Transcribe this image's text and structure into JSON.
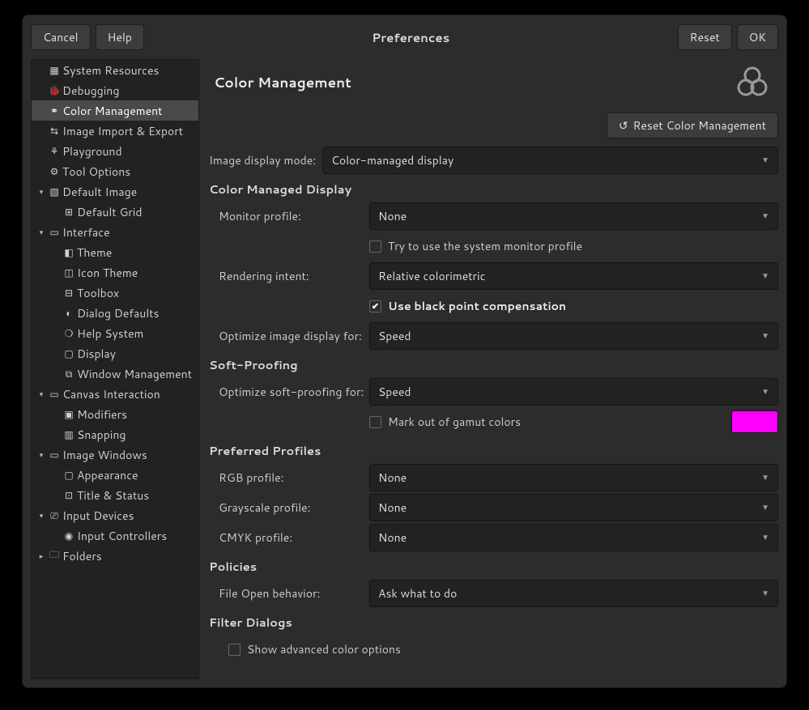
{
  "titlebar": {
    "cancel": "Cancel",
    "help": "Help",
    "title": "Preferences",
    "reset": "Reset",
    "ok": "OK"
  },
  "sidebar": {
    "items": [
      {
        "icon": "▦",
        "label": "System Resources",
        "indent": 1,
        "exp": ""
      },
      {
        "icon": "🐞",
        "label": "Debugging",
        "indent": 1,
        "exp": ""
      },
      {
        "icon": "⚭",
        "label": "Color Management",
        "indent": 1,
        "exp": "",
        "selected": true
      },
      {
        "icon": "⇆",
        "label": "Image Import & Export",
        "indent": 1,
        "exp": ""
      },
      {
        "icon": "⚘",
        "label": "Playground",
        "indent": 1,
        "exp": ""
      },
      {
        "icon": "⚙",
        "label": "Tool Options",
        "indent": 1,
        "exp": ""
      },
      {
        "icon": "▧",
        "label": "Default Image",
        "indent": 0,
        "exp": "▾"
      },
      {
        "icon": "⊞",
        "label": "Default Grid",
        "indent": 2,
        "exp": ""
      },
      {
        "icon": "▭",
        "label": "Interface",
        "indent": 0,
        "exp": "▾"
      },
      {
        "icon": "◧",
        "label": "Theme",
        "indent": 2,
        "exp": ""
      },
      {
        "icon": "◫",
        "label": "Icon Theme",
        "indent": 2,
        "exp": ""
      },
      {
        "icon": "⊟",
        "label": "Toolbox",
        "indent": 2,
        "exp": ""
      },
      {
        "icon": "◐",
        "label": "Dialog Defaults",
        "indent": 2,
        "exp": ""
      },
      {
        "icon": "❍",
        "label": "Help System",
        "indent": 2,
        "exp": ""
      },
      {
        "icon": "▢",
        "label": "Display",
        "indent": 2,
        "exp": ""
      },
      {
        "icon": "⧉",
        "label": "Window Management",
        "indent": 2,
        "exp": ""
      },
      {
        "icon": "▭",
        "label": "Canvas Interaction",
        "indent": 0,
        "exp": "▾"
      },
      {
        "icon": "▣",
        "label": "Modifiers",
        "indent": 2,
        "exp": ""
      },
      {
        "icon": "▥",
        "label": "Snapping",
        "indent": 2,
        "exp": ""
      },
      {
        "icon": "▭",
        "label": "Image Windows",
        "indent": 0,
        "exp": "▾"
      },
      {
        "icon": "▢",
        "label": "Appearance",
        "indent": 2,
        "exp": ""
      },
      {
        "icon": "⊡",
        "label": "Title & Status",
        "indent": 2,
        "exp": ""
      },
      {
        "icon": "⎚",
        "label": "Input Devices",
        "indent": 0,
        "exp": "▾"
      },
      {
        "icon": "◉",
        "label": "Input Controllers",
        "indent": 2,
        "exp": ""
      },
      {
        "icon": "🗀",
        "label": "Folders",
        "indent": 0,
        "exp": "▸"
      }
    ]
  },
  "page": {
    "title": "Color Management",
    "reset_btn": "Reset Color Management",
    "image_display_mode_label": "Image display mode:",
    "image_display_mode_value": "Color-managed display",
    "section_cmd": "Color Managed Display",
    "monitor_profile_label": "Monitor profile:",
    "monitor_profile_value": "None",
    "try_system_profile": "Try to use the system monitor profile",
    "rendering_intent_label": "Rendering intent:",
    "rendering_intent_value": "Relative colorimetric",
    "black_point": "Use black point compensation",
    "optimize_display_label": "Optimize image display for:",
    "optimize_display_value": "Speed",
    "section_soft": "Soft-Proofing",
    "optimize_soft_label": "Optimize soft-proofing for:",
    "optimize_soft_value": "Speed",
    "mark_gamut": "Mark out of gamut colors",
    "gamut_color": "#ff00ff",
    "section_pref": "Preferred Profiles",
    "rgb_label": "RGB profile:",
    "rgb_value": "None",
    "gray_label": "Grayscale profile:",
    "gray_value": "None",
    "cmyk_label": "CMYK profile:",
    "cmyk_value": "None",
    "section_policies": "Policies",
    "file_open_label": "File Open behavior:",
    "file_open_value": "Ask what to do",
    "section_filter": "Filter Dialogs",
    "show_advanced": "Show advanced color options"
  }
}
